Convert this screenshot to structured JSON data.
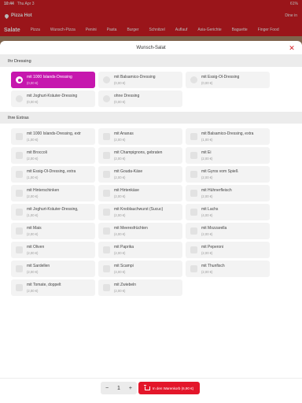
{
  "status": {
    "time": "10:44",
    "date": "Thu Apr 3",
    "right": "61%"
  },
  "app": {
    "name": "Pizza Hot",
    "login": "Dine in"
  },
  "categories": [
    "Salate",
    "Pizza",
    "Wunsch-Pizza",
    "Penini",
    "Pasta",
    "Burger",
    "Schnitzel",
    "Auflauf",
    "Asia-Gerichte",
    "Baguette",
    "Finger Food"
  ],
  "modal": {
    "title": "Wunsch-Salat",
    "close": "✕",
    "dressing_header": "Ihr Dressing",
    "extras_header": "Ihre Extras"
  },
  "dressings": [
    {
      "name": "mit 1000 Islands-Dressing",
      "price": "(0,00 €)",
      "selected": true
    },
    {
      "name": "mit Balsamico-Dressing",
      "price": "(0,00 €)",
      "selected": false
    },
    {
      "name": "mit Essig-Öl-Dressing",
      "price": "(0,00 €)",
      "selected": false
    },
    {
      "name": "mit Joghurt-Kräuter-Dressing",
      "price": "(0,00 €)",
      "selected": false
    },
    {
      "name": "ohne Dressing",
      "price": "(0,00 €)",
      "selected": false
    }
  ],
  "extras": [
    {
      "name": "mit 1000 Islands-Dressing, extr",
      "price": "(1,00 €)"
    },
    {
      "name": "mit Ananas",
      "price": "(2,00 €)"
    },
    {
      "name": "mit Balsamico-Dressing, extra",
      "price": "(1,00 €)"
    },
    {
      "name": "mit Broccoli",
      "price": "(2,00 €)"
    },
    {
      "name": "mit Champignons, gebraten",
      "price": "(2,00 €)"
    },
    {
      "name": "mit Ei",
      "price": "(2,00 €)"
    },
    {
      "name": "mit Essig-Öl-Dressing, extra",
      "price": "(1,00 €)"
    },
    {
      "name": "mit Gouda-Käse",
      "price": "(2,00 €)"
    },
    {
      "name": "mit Gyros vom Spieß",
      "price": "(2,00 €)"
    },
    {
      "name": "mit Hinterschinken",
      "price": "(2,00 €)"
    },
    {
      "name": "mit Hirtenkäse",
      "price": "(2,00 €)"
    },
    {
      "name": "mit Hühnerfleisch",
      "price": "(2,00 €)"
    },
    {
      "name": "mit Joghurt-Kräuter-Dressing,",
      "price": "(1,00 €)"
    },
    {
      "name": "mit Knoblauchwurst (Sucuc)",
      "price": "(2,00 €)"
    },
    {
      "name": "mit Lachs",
      "price": "(4,00 €)"
    },
    {
      "name": "mit Mais",
      "price": "(2,00 €)"
    },
    {
      "name": "mit Meeresfrüchten",
      "price": "(4,00 €)"
    },
    {
      "name": "mit Mozzarella",
      "price": "(2,00 €)"
    },
    {
      "name": "mit Oliven",
      "price": "(2,00 €)"
    },
    {
      "name": "mit Paprika",
      "price": "(2,00 €)"
    },
    {
      "name": "mit Peperoni",
      "price": "(2,00 €)"
    },
    {
      "name": "mit Sardellen",
      "price": "(2,00 €)"
    },
    {
      "name": "mit Scampi",
      "price": "(4,00 €)"
    },
    {
      "name": "mit Thunfisch",
      "price": "(2,00 €)"
    },
    {
      "name": "mit Tomate, doppelt",
      "price": "(2,00 €)"
    },
    {
      "name": "mit Zwiebeln",
      "price": "(2,00 €)"
    }
  ],
  "footer": {
    "minus": "−",
    "qty": "1",
    "plus": "+",
    "cart_label": "In den Warenkorb (6,90 €)"
  },
  "colors": {
    "brand": "#d61e24",
    "selected": "#c617ae"
  }
}
